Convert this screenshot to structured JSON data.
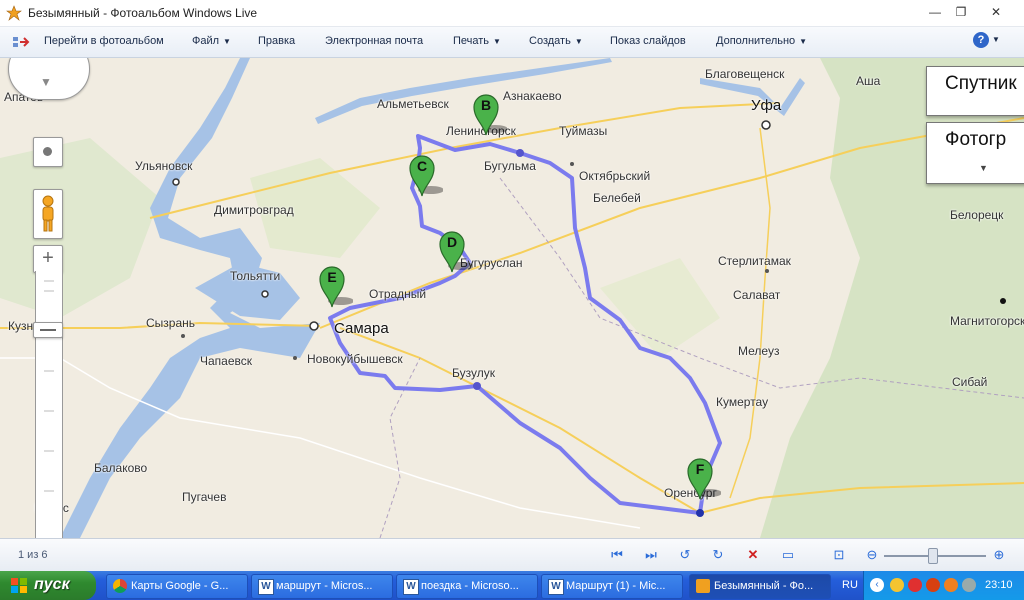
{
  "window": {
    "title": "Безымянный - Фотоальбом Windows Live",
    "minimize": "—",
    "maximize": "❐",
    "close": "✕"
  },
  "menubar": {
    "goto_label": "Перейти в фотоальбом",
    "items": [
      "Файл",
      "Правка",
      "Электронная почта",
      "Печать",
      "Создать",
      "Показ слайдов",
      "Дополнительно"
    ],
    "help": "?"
  },
  "map": {
    "cities": [
      "Альметьевск",
      "Азнакаево",
      "Лениногорск",
      "Туймазы",
      "Благовещенск",
      "Аша",
      "Уфа",
      "Ульяновск",
      "Бугульма",
      "Октябрьский",
      "Белебей",
      "Димитровград",
      "Бугуруслан",
      "Белорецк",
      "Стерлитамак",
      "Тольятти",
      "Отрадный",
      "Салават",
      "Самара",
      "Сызрань",
      "Кузнецк",
      "Магнитогорск",
      "Чапаевск",
      "Новокуйбышевск",
      "Мелеуз",
      "Бузулук",
      "Кумертау",
      "Сибай",
      "Балаково",
      "Оренбург",
      "Пугачев",
      "Маркс",
      "Апатов"
    ],
    "markers": [
      "B",
      "C",
      "D",
      "E",
      "F"
    ],
    "maptype_satellite": "Спутник",
    "maptype_photo": "Фотогр",
    "zoom_in": "+",
    "zoom_out": "−"
  },
  "viewer": {
    "counter": "1 из 6"
  },
  "taskbar": {
    "start": "пуск",
    "tasks": [
      "Карты Google - G...",
      "маршрут - Micros...",
      "поездка - Microso...",
      "Маршрут (1) - Mic...",
      "Безымянный - Фо..."
    ],
    "language": "RU",
    "clock": "23:10"
  },
  "colors": {
    "route": "#7b7bee",
    "marker": "#4ab24a",
    "taskbar": "#245edb",
    "start": "#2f8a2f"
  }
}
